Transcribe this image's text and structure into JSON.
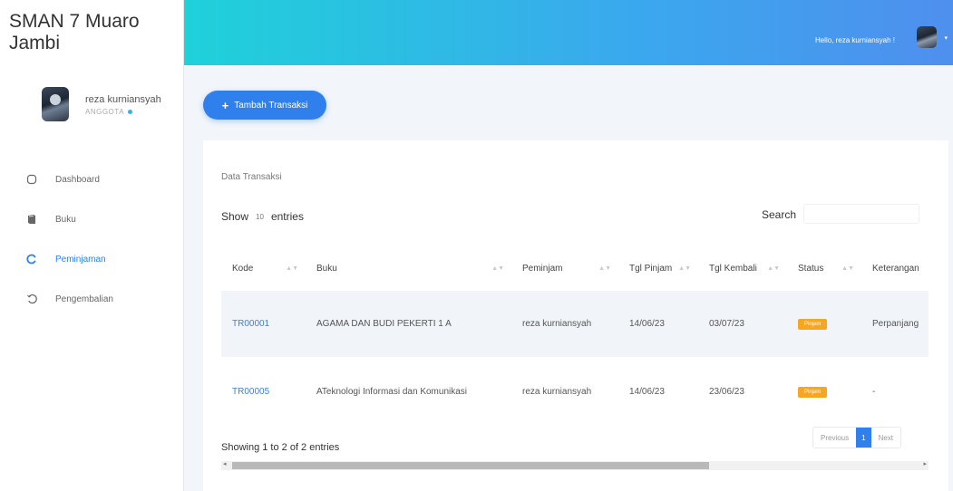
{
  "brand": {
    "title": "SMAN 7 Muaro Jambi"
  },
  "user": {
    "name": "reza kurniansyah",
    "role": "ANGGOTA"
  },
  "sidebar": {
    "items": [
      {
        "label": "Dashboard",
        "icon": "circle-icon"
      },
      {
        "label": "Buku",
        "icon": "book-icon"
      },
      {
        "label": "Peminjaman",
        "icon": "refresh-icon",
        "active": true
      },
      {
        "label": "Pengembalian",
        "icon": "undo-icon"
      }
    ]
  },
  "header": {
    "greeting": "Hello, reza kurniansyah !"
  },
  "toolbar": {
    "add_label": "Tambah Transaksi"
  },
  "card": {
    "title": "Data Transaksi",
    "show_label": "Show",
    "entries_value": "10",
    "entries_label": "entries",
    "search_label": "Search"
  },
  "table": {
    "headers": [
      "Kode",
      "Buku",
      "Peminjam",
      "Tgl Pinjam",
      "Tgl Kembali",
      "Status",
      "Keterangan"
    ],
    "rows": [
      {
        "kode": "TR00001",
        "buku": "AGAMA DAN BUDI PEKERTI 1 A",
        "peminjam": "reza kurniansyah",
        "tgl_pinjam": "14/06/23",
        "tgl_kembali": "03/07/23",
        "status": "Pinjam",
        "keterangan": "Perpanjang"
      },
      {
        "kode": "TR00005",
        "buku": "ATeknologi Informasi dan Komunikasi",
        "peminjam": "reza kurniansyah",
        "tgl_pinjam": "14/06/23",
        "tgl_kembali": "23/06/23",
        "status": "Pinjam",
        "keterangan": "-"
      }
    ]
  },
  "footer": {
    "info": "Showing 1 to 2 of 2 entries",
    "previous": "Previous",
    "page": "1",
    "next": "Next"
  },
  "colors": {
    "accent": "#2f80ed",
    "header_start": "#1fd1d9",
    "header_end": "#4f8fee",
    "badge": "#f5a623"
  }
}
